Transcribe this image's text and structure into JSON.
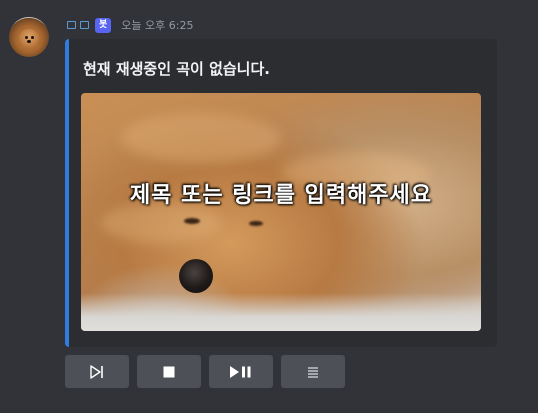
{
  "message": {
    "bot_tag": "봇",
    "timestamp": "오늘 오후 6:25"
  },
  "embed": {
    "accent_color": "#2f7de1",
    "title": "현재 재생중인 곡이 없습니다.",
    "image_overlay_text": "제목 또는 링크를 입력해주세요"
  },
  "controls": [
    {
      "icon": "skip-icon"
    },
    {
      "icon": "stop-icon"
    },
    {
      "icon": "play-pause-icon"
    },
    {
      "icon": "queue-list-icon"
    }
  ]
}
